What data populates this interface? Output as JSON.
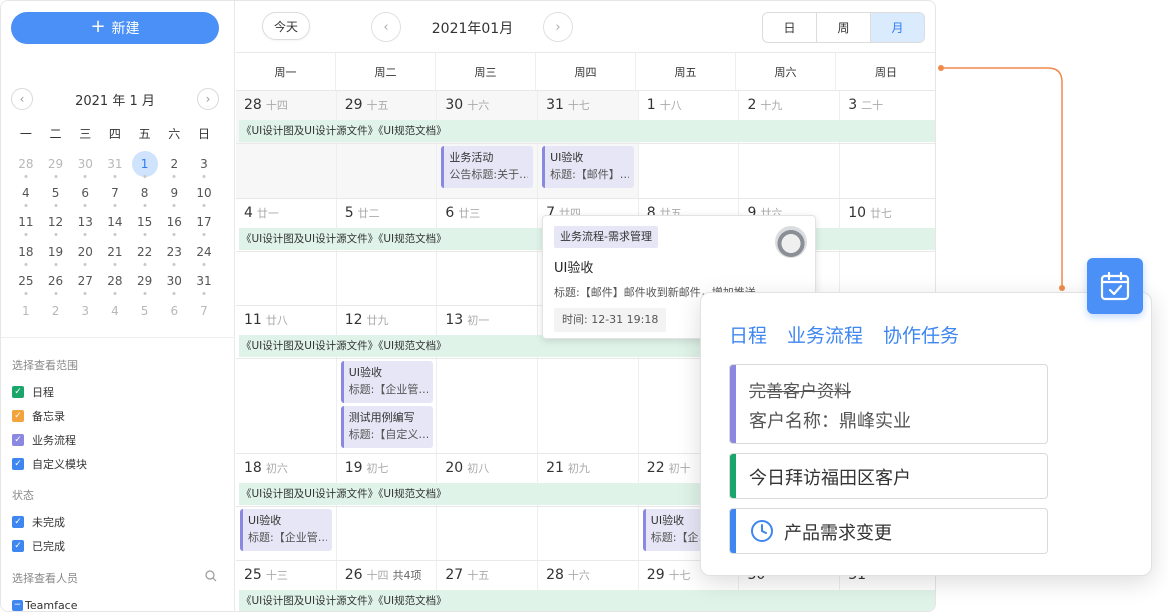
{
  "sidebar": {
    "new_button": "新建",
    "mini_title": "2021 年 1 月",
    "weekdays": [
      "一",
      "二",
      "三",
      "四",
      "五",
      "六",
      "日"
    ],
    "weeks": [
      [
        "28",
        "29",
        "30",
        "31",
        "1",
        "2",
        "3"
      ],
      [
        "4",
        "5",
        "6",
        "7",
        "8",
        "9",
        "10"
      ],
      [
        "11",
        "12",
        "13",
        "14",
        "15",
        "16",
        "17"
      ],
      [
        "18",
        "19",
        "20",
        "21",
        "22",
        "23",
        "24"
      ],
      [
        "25",
        "26",
        "27",
        "28",
        "29",
        "30",
        "31"
      ],
      [
        "1",
        "2",
        "3",
        "4",
        "5",
        "6",
        "7"
      ]
    ],
    "scope_label": "选择查看范围",
    "scope_items": [
      {
        "label": "日程",
        "color": "#1aa56a"
      },
      {
        "label": "备忘录",
        "color": "#f2a33a"
      },
      {
        "label": "业务流程",
        "color": "#8a88e0"
      },
      {
        "label": "自定义模块",
        "color": "#3e86f0"
      }
    ],
    "status_label": "状态",
    "status_items": [
      {
        "label": "未完成",
        "color": "#3e86f0"
      },
      {
        "label": "已完成",
        "color": "#3e86f0"
      }
    ],
    "people_label": "选择查看人员",
    "people_item": "Teamface"
  },
  "toolbar": {
    "today": "今天",
    "month_title": "2021年01月",
    "views": [
      "日",
      "周",
      "月"
    ]
  },
  "weekheader": [
    "周一",
    "周二",
    "周三",
    "周四",
    "周五",
    "周六",
    "周日"
  ],
  "calendar": {
    "band_text": "《UI设计图及UI设计源文件》《UI规范文档》",
    "weeks": [
      {
        "days": [
          [
            "28",
            "十四"
          ],
          [
            "29",
            "十五"
          ],
          [
            "30",
            "十六"
          ],
          [
            "31",
            "十七"
          ],
          [
            "1",
            "十八"
          ],
          [
            "2",
            "十九"
          ],
          [
            "3",
            "二十"
          ]
        ]
      },
      {
        "days": [
          [
            "4",
            "廿一"
          ],
          [
            "5",
            "廿二"
          ],
          [
            "6",
            "廿三"
          ],
          [
            "7",
            "廿四"
          ],
          [
            "8",
            "廿五"
          ],
          [
            "9",
            "廿六"
          ],
          [
            "10",
            "廿七"
          ]
        ]
      },
      {
        "days": [
          [
            "11",
            "廿八"
          ],
          [
            "12",
            "廿九"
          ],
          [
            "13",
            "初一"
          ],
          [
            "14",
            ""
          ],
          [
            "15",
            ""
          ],
          [
            "16",
            ""
          ],
          [
            "17",
            ""
          ]
        ]
      },
      {
        "days": [
          [
            "18",
            "初六"
          ],
          [
            "19",
            "初七"
          ],
          [
            "20",
            "初八"
          ],
          [
            "21",
            "初九"
          ],
          [
            "22",
            "初十"
          ],
          [
            "23",
            ""
          ],
          [
            "24",
            ""
          ]
        ]
      },
      {
        "days": [
          [
            "25",
            "十三"
          ],
          [
            "26",
            "十四"
          ],
          [
            "27",
            "十五"
          ],
          [
            "28",
            "十六"
          ],
          [
            "29",
            "十七"
          ],
          [
            "30",
            ""
          ],
          [
            "31",
            ""
          ]
        ]
      }
    ],
    "count_label": "共4项",
    "events": {
      "w1_biz": {
        "t1": "业务活动",
        "t2": "公告标题:关于…"
      },
      "w1_ui": {
        "t1": "UI验收",
        "t2": "标题:【邮件】…"
      },
      "w3_ui": {
        "t1": "UI验收",
        "t2": "标题:【企业管…"
      },
      "w3_test": {
        "t1": "测试用例编写",
        "t2": "标题:【自定义…"
      },
      "w4_ui1": {
        "t1": "UI验收",
        "t2": "标题:【企业管…"
      },
      "w4_ui2": {
        "t1": "UI验收",
        "t2": "标题:【企…"
      }
    }
  },
  "popover": {
    "tag": "业务流程-需求管理",
    "title": "UI验收",
    "desc": "标题:【邮件】邮件收到新邮件，增加推送",
    "time": "时间: 12-31 19:18"
  },
  "card": {
    "tabs": [
      "日程",
      "业务流程",
      "协作任务"
    ],
    "task1_line1": "完善客户资料",
    "task1_line2": "客户名称：鼎峰实业",
    "task2": "今日拜访福田区客户",
    "task3": "产品需求变更",
    "colors": {
      "task1": "#8a88e0",
      "task2": "#1aa56a",
      "task3": "#3e86f0",
      "connector": "#f08a4b"
    }
  }
}
